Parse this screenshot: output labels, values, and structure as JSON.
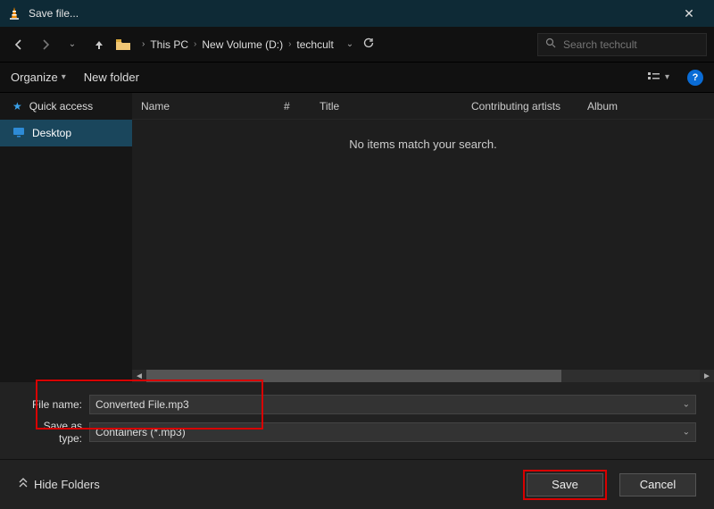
{
  "window": {
    "title": "Save file..."
  },
  "breadcrumb": {
    "root": "This PC",
    "volume": "New Volume (D:)",
    "folder": "techcult"
  },
  "search": {
    "placeholder": "Search techcult"
  },
  "toolbar": {
    "organize": "Organize",
    "newfolder": "New folder"
  },
  "sidebar": {
    "quick_access": "Quick access",
    "desktop": "Desktop"
  },
  "columns": {
    "name": "Name",
    "num": "#",
    "title": "Title",
    "contrib": "Contributing artists",
    "album": "Album"
  },
  "filearea": {
    "empty": "No items match your search."
  },
  "fields": {
    "filename_label": "File name:",
    "filename_value": "Converted File.mp3",
    "saveas_label": "Save as type:",
    "saveas_value": "Containers (*.mp3)"
  },
  "footer": {
    "hide_folders": "Hide Folders",
    "save": "Save",
    "cancel": "Cancel"
  }
}
